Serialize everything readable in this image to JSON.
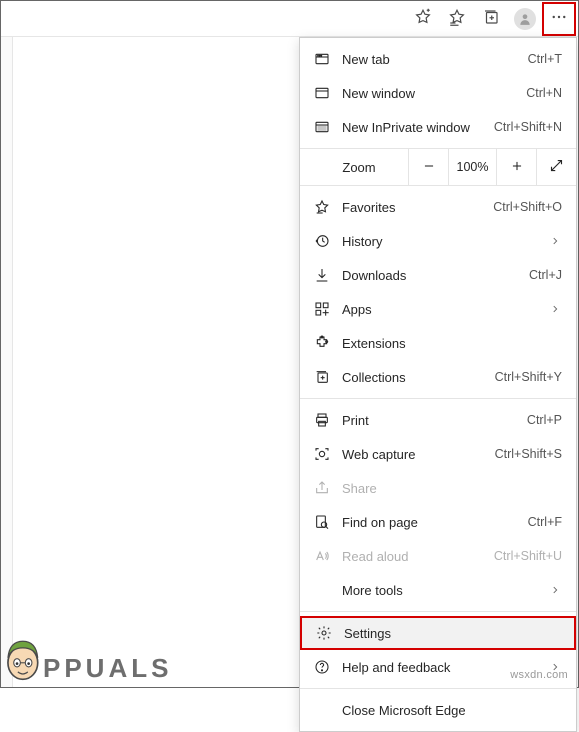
{
  "watermark": "wsxdn.com",
  "logo_text": "PPUALS",
  "menu": {
    "new_tab": {
      "label": "New tab",
      "shortcut": "Ctrl+T"
    },
    "new_window": {
      "label": "New window",
      "shortcut": "Ctrl+N"
    },
    "new_inprivate": {
      "label": "New InPrivate window",
      "shortcut": "Ctrl+Shift+N"
    },
    "zoom": {
      "label": "Zoom",
      "value": "100%"
    },
    "favorites": {
      "label": "Favorites",
      "shortcut": "Ctrl+Shift+O"
    },
    "history": {
      "label": "History"
    },
    "downloads": {
      "label": "Downloads",
      "shortcut": "Ctrl+J"
    },
    "apps": {
      "label": "Apps"
    },
    "extensions": {
      "label": "Extensions"
    },
    "collections": {
      "label": "Collections",
      "shortcut": "Ctrl+Shift+Y"
    },
    "print": {
      "label": "Print",
      "shortcut": "Ctrl+P"
    },
    "web_capture": {
      "label": "Web capture",
      "shortcut": "Ctrl+Shift+S"
    },
    "share": {
      "label": "Share"
    },
    "find": {
      "label": "Find on page",
      "shortcut": "Ctrl+F"
    },
    "read_aloud": {
      "label": "Read aloud",
      "shortcut": "Ctrl+Shift+U"
    },
    "more_tools": {
      "label": "More tools"
    },
    "settings": {
      "label": "Settings"
    },
    "help": {
      "label": "Help and feedback"
    },
    "close": {
      "label": "Close Microsoft Edge"
    }
  }
}
